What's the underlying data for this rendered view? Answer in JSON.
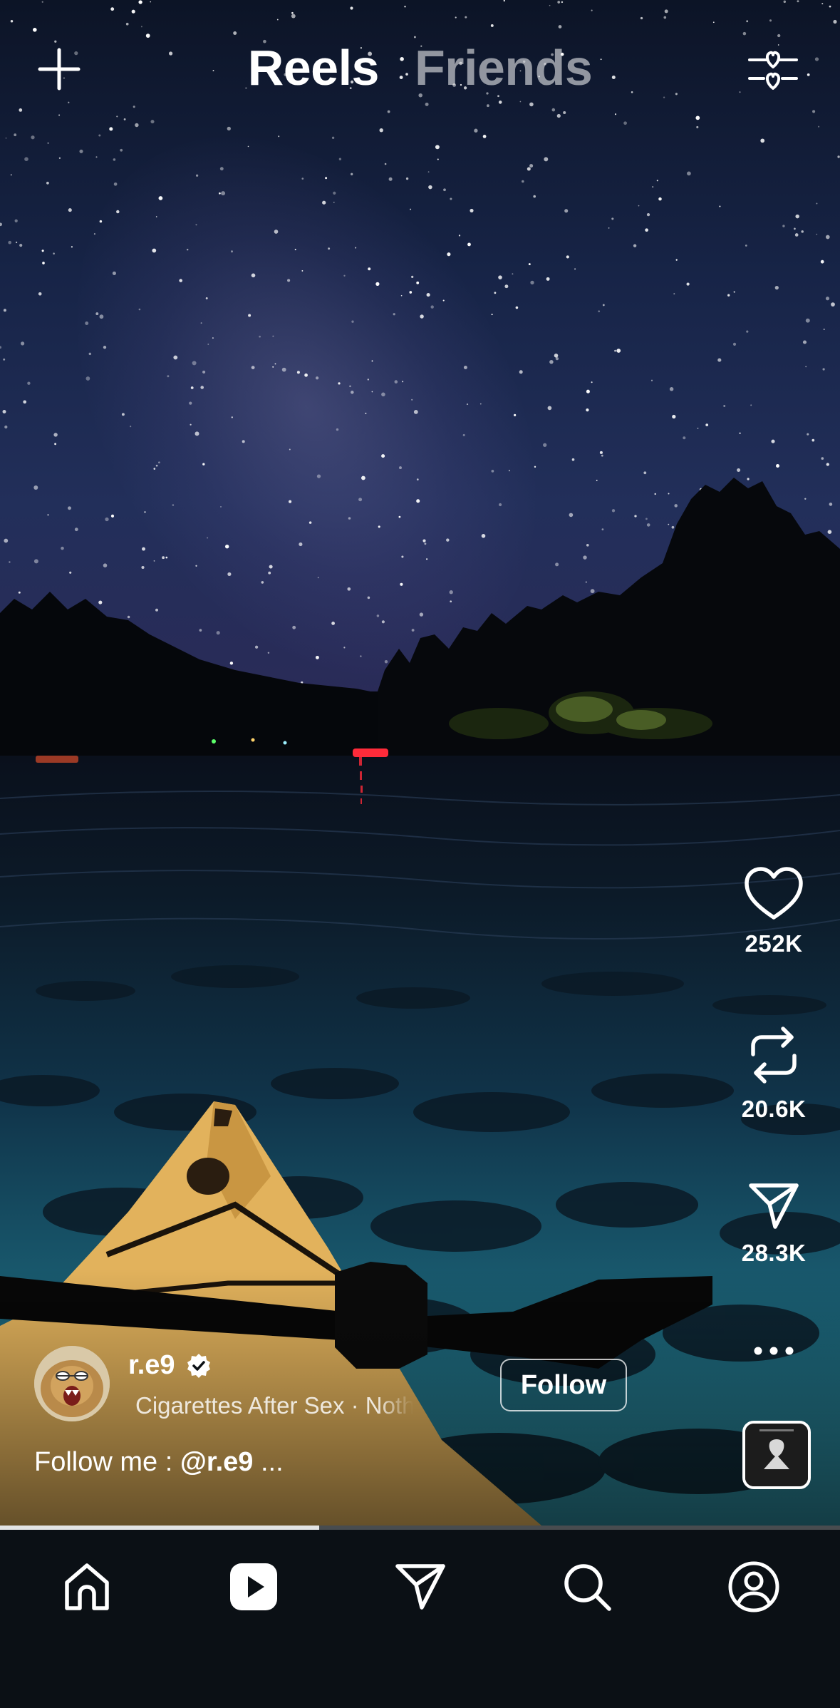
{
  "header": {
    "create_icon": "plus-icon",
    "tabs": [
      {
        "label": "Reels",
        "active": true
      },
      {
        "label": "Friends",
        "active": false
      }
    ],
    "filter_icon": "hearts-filter-icon"
  },
  "actions": {
    "like": {
      "icon": "heart-icon",
      "count": "252K"
    },
    "remix": {
      "icon": "repost-icon",
      "count": "20.6K"
    },
    "share": {
      "icon": "send-icon",
      "count": "28.3K"
    },
    "more": {
      "icon": "more-icon"
    },
    "audio": {
      "icon": "audio-cover-thumbnail"
    }
  },
  "creator": {
    "username": "r.e9",
    "verified": true,
    "audio_text": "Cigarettes After Sex · Nothing's Gonna Hurt You Baby",
    "follow_label": "Follow"
  },
  "caption": {
    "prefix": "Follow me : ",
    "handle": "@r.e9",
    "suffix": " ..."
  },
  "playback": {
    "progress": 0.38
  },
  "bottom_nav": [
    {
      "icon": "home-icon",
      "active": false
    },
    {
      "icon": "reels-icon",
      "active": true
    },
    {
      "icon": "send-icon",
      "active": false
    },
    {
      "icon": "search-icon",
      "active": false
    },
    {
      "icon": "profile-icon",
      "active": false
    }
  ],
  "colors": {
    "background": "#0b1015",
    "text": "#ffffff",
    "inactive_tab": "#8f9296",
    "boat_light": "#ff2b3a"
  }
}
